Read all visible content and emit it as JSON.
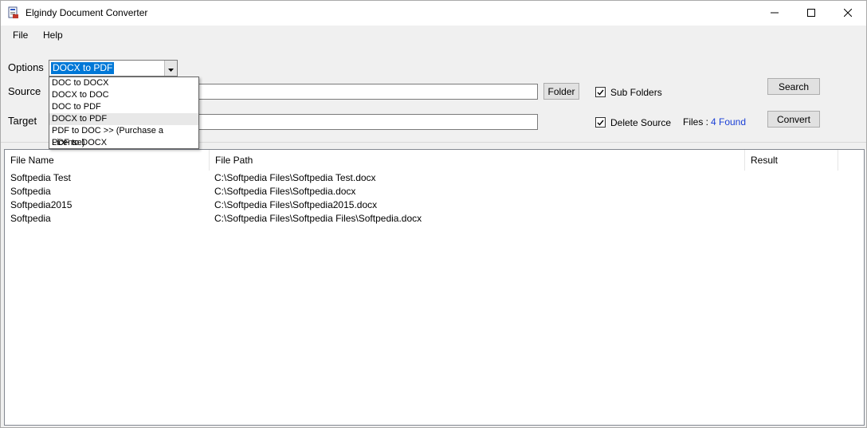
{
  "window": {
    "title": "Elgindy Document Converter"
  },
  "menu": {
    "file": "File",
    "help": "Help"
  },
  "options": {
    "label": "Options",
    "selected": "DOCX to PDF",
    "items": [
      "DOC to DOCX",
      "DOCX to DOC",
      "DOC to PDF",
      "DOCX to PDF",
      "PDF to DOC >> (Purchase a License)",
      "PDF to DOCX"
    ]
  },
  "source": {
    "label": "Source",
    "value": "",
    "folder_button": "Folder"
  },
  "target": {
    "label": "Target",
    "value": ""
  },
  "checks": {
    "sub_folders": "Sub Folders",
    "sub_folders_checked": true,
    "delete_source": "Delete Source",
    "delete_source_checked": true
  },
  "files": {
    "label": "Files :",
    "count": "4 Found"
  },
  "buttons": {
    "search": "Search",
    "convert": "Convert"
  },
  "table": {
    "columns": [
      "File Name",
      "File Path",
      "Result"
    ],
    "rows": [
      {
        "name": "Softpedia Test",
        "path": "C:\\Softpedia Files\\Softpedia Test.docx",
        "result": ""
      },
      {
        "name": "Softpedia",
        "path": "C:\\Softpedia Files\\Softpedia.docx",
        "result": ""
      },
      {
        "name": "Softpedia2015",
        "path": "C:\\Softpedia Files\\Softpedia2015.docx",
        "result": ""
      },
      {
        "name": "Softpedia",
        "path": "C:\\Softpedia Files\\Softpedia Files\\Softpedia.docx",
        "result": ""
      }
    ]
  },
  "colors": {
    "selection": "#0078d7",
    "count_text": "#1a3fd6"
  },
  "icons": {
    "app": "document-convert-icon",
    "minimize": "minimize-icon",
    "maximize": "maximize-icon",
    "close": "close-icon",
    "dropdown": "chevron-down-icon",
    "check": "checkmark-icon"
  }
}
